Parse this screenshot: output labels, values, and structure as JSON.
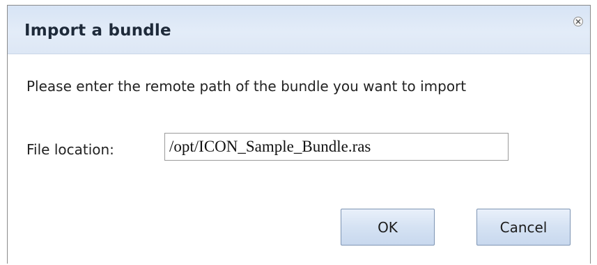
{
  "dialog": {
    "title": "Import a bundle",
    "instruction": "Please enter the remote path of the bundle you want to import",
    "file_location_label": "File location:",
    "file_location_value": "/opt/ICON_Sample_Bundle.ras",
    "ok_label": "OK",
    "cancel_label": "Cancel",
    "close_icon": "close-circle-icon"
  },
  "colors": {
    "titlebar_bg": "#dde7f5",
    "button_bg": "#d5e2f3",
    "button_border": "#7d94b3"
  }
}
